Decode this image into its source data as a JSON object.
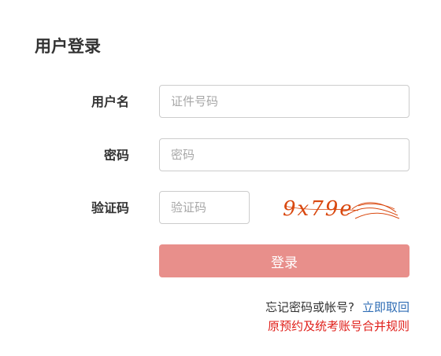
{
  "page": {
    "title": "用户登录"
  },
  "form": {
    "username": {
      "label": "用户名",
      "placeholder": "证件号码",
      "value": ""
    },
    "password": {
      "label": "密码",
      "placeholder": "密码",
      "value": ""
    },
    "captcha": {
      "label": "验证码",
      "placeholder": "验证码",
      "value": "",
      "image_text": "9x79e"
    },
    "login_button": "登录"
  },
  "links": {
    "forgot_question": "忘记密码或帐号?",
    "retrieve": "立即取回",
    "merge_rules": "原预约及统考账号合并规则"
  },
  "colors": {
    "button_bg": "#e88f8b",
    "link_blue": "#2f6db5",
    "link_red": "#e0201b",
    "captcha_text": "#d9480f"
  }
}
